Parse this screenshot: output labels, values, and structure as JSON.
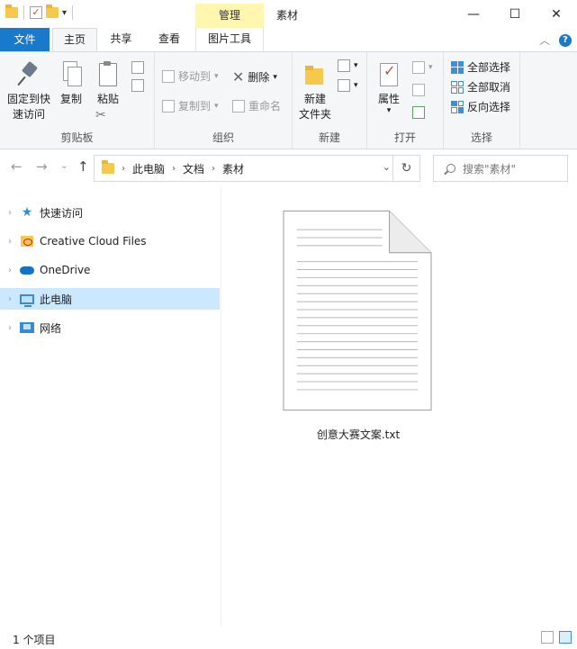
{
  "window": {
    "context_tab": "管理",
    "title": "素材",
    "controls": {
      "minimize": "—",
      "maximize": "☐",
      "close": "✕"
    }
  },
  "ribbon_tabs": {
    "file": "文件",
    "home": "主页",
    "share": "共享",
    "view": "查看",
    "picture_tools": "图片工具"
  },
  "ribbon": {
    "clipboard": {
      "label": "剪贴板",
      "pin_line1": "固定到快",
      "pin_line2": "速访问",
      "copy": "复制",
      "paste": "粘贴"
    },
    "organize": {
      "label": "组织",
      "move_to": "移动到",
      "copy_to": "复制到",
      "delete": "删除",
      "rename": "重命名"
    },
    "new": {
      "label": "新建",
      "new_folder_line1": "新建",
      "new_folder_line2": "文件夹"
    },
    "open": {
      "label": "打开",
      "properties": "属性"
    },
    "select": {
      "label": "选择",
      "select_all": "全部选择",
      "select_none": "全部取消",
      "invert": "反向选择"
    }
  },
  "address": {
    "crumbs": [
      "此电脑",
      "文档",
      "素材"
    ],
    "search_placeholder": "搜索\"素材\""
  },
  "nav_pane": {
    "items": [
      {
        "label": "快速访问",
        "icon": "star-icon"
      },
      {
        "label": "Creative Cloud Files",
        "icon": "creative-cloud-folder-icon"
      },
      {
        "label": "OneDrive",
        "icon": "cloud-icon"
      },
      {
        "label": "此电脑",
        "icon": "computer-icon",
        "selected": true
      },
      {
        "label": "网络",
        "icon": "network-icon"
      }
    ]
  },
  "content": {
    "file_name": "创意大赛文案.txt",
    "file_icon": "text-document-icon"
  },
  "status": {
    "item_count": "1 个项目"
  },
  "colors": {
    "accent": "#1979ca",
    "selection": "#cce8ff",
    "context_tab": "#fff7b0"
  }
}
